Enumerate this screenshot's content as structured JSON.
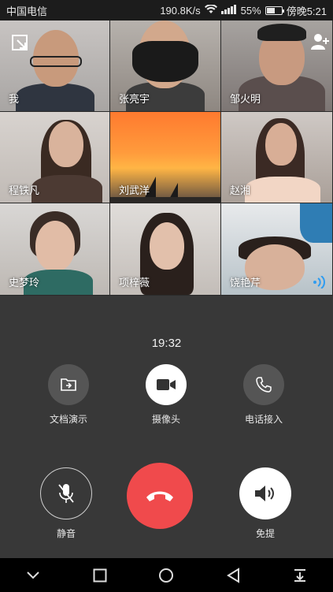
{
  "status_bar": {
    "carrier": "中国电信",
    "speed": "190.8K/s",
    "battery": "55%",
    "battery_level": 0.55,
    "time": "傍晚5:21"
  },
  "participants": [
    {
      "name": "我"
    },
    {
      "name": "张亮宇"
    },
    {
      "name": "邹火明"
    },
    {
      "name": "程铁凡"
    },
    {
      "name": "刘武洋"
    },
    {
      "name": "赵湘"
    },
    {
      "name": "史梦玲"
    },
    {
      "name": "项梓薇"
    },
    {
      "name": "饶艳芹"
    }
  ],
  "call": {
    "timer": "19:32",
    "controls": {
      "screen_share": "文档演示",
      "camera": "摄像头",
      "phone_in": "电话接入",
      "mute": "静音",
      "speaker": "免提"
    }
  },
  "colors": {
    "hangup": "#f04a4c",
    "panel": "#383838",
    "button_gray": "#555555"
  },
  "icons": {
    "top_left": "switch-view-icon",
    "top_right": "add-person-icon",
    "speaking": "audio-wave-icon"
  }
}
